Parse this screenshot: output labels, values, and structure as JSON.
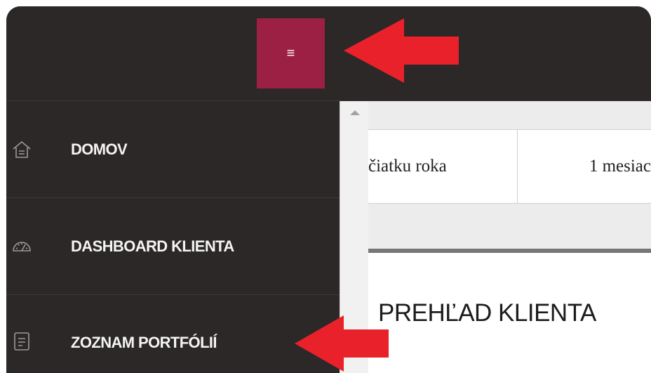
{
  "header": {
    "menu_button_glyph": "≡",
    "menu_button_color": "#9c2044"
  },
  "sidebar": {
    "items": [
      {
        "label": "DOMOV",
        "icon": "home-icon"
      },
      {
        "label": "DASHBOARD KLIENTA",
        "icon": "speedometer-icon"
      },
      {
        "label": "ZOZNAM PORTFÓLIÍ",
        "icon": "document-icon"
      }
    ]
  },
  "content": {
    "filters": [
      "čiatku roka",
      "1 mesiac"
    ],
    "section_title": "PREHĽAD KLIENTA"
  },
  "annotations": {
    "arrow_color": "#e8212a"
  }
}
